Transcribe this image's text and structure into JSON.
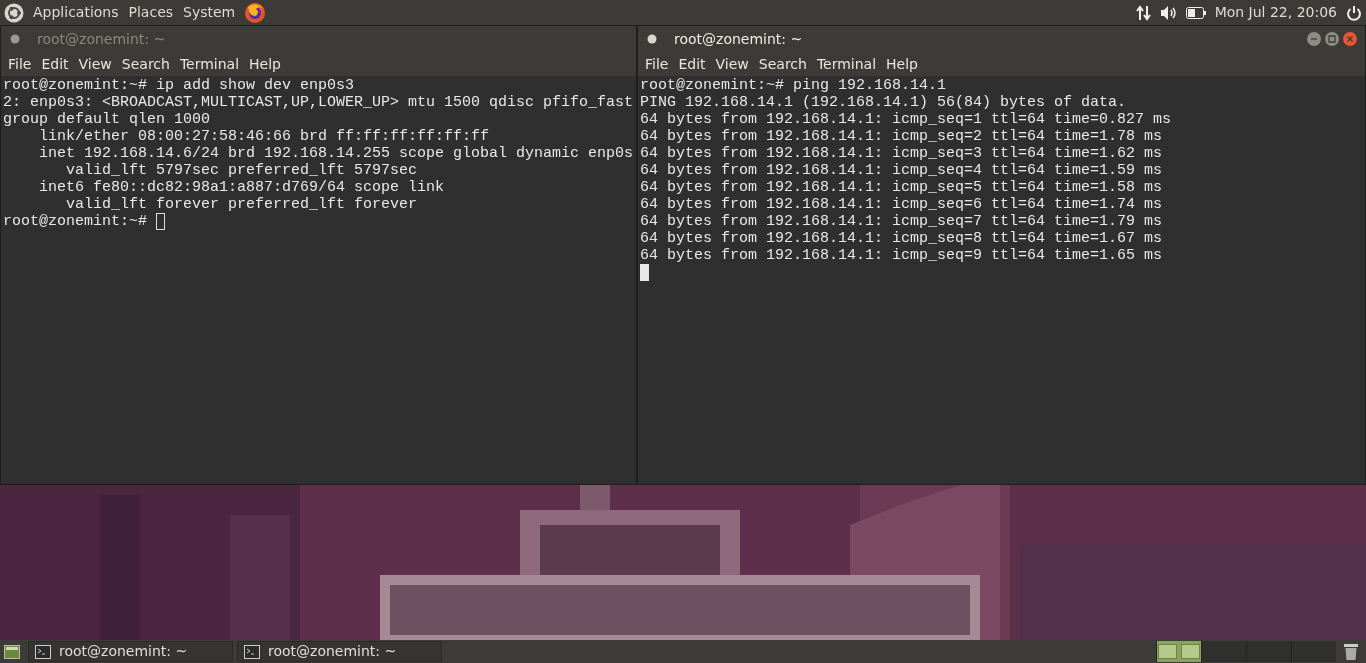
{
  "top_panel": {
    "menus": [
      "Applications",
      "Places",
      "System"
    ],
    "clock": "Mon Jul 22, 20:06"
  },
  "windows": [
    {
      "title": "root@zonemint: ~",
      "focused": false,
      "menu": [
        "File",
        "Edit",
        "View",
        "Search",
        "Terminal",
        "Help"
      ],
      "lines": [
        "root@zonemint:~# ip add show dev enp0s3",
        "2: enp0s3: <BROADCAST,MULTICAST,UP,LOWER_UP> mtu 1500 qdisc pfifo_fast",
        "group default qlen 1000",
        "    link/ether 08:00:27:58:46:66 brd ff:ff:ff:ff:ff:ff",
        "    inet 192.168.14.6/24 brd 192.168.14.255 scope global dynamic enp0s",
        "       valid_lft 5797sec preferred_lft 5797sec",
        "    inet6 fe80::dc82:98a1:a887:d769/64 scope link",
        "       valid_lft forever preferred_lft forever"
      ],
      "prompt": "root@zonemint:~#"
    },
    {
      "title": "root@zonemint: ~",
      "focused": true,
      "menu": [
        "File",
        "Edit",
        "View",
        "Search",
        "Terminal",
        "Help"
      ],
      "lines": [
        "root@zonemint:~# ping 192.168.14.1",
        "PING 192.168.14.1 (192.168.14.1) 56(84) bytes of data.",
        "64 bytes from 192.168.14.1: icmp_seq=1 ttl=64 time=0.827 ms",
        "64 bytes from 192.168.14.1: icmp_seq=2 ttl=64 time=1.78 ms",
        "64 bytes from 192.168.14.1: icmp_seq=3 ttl=64 time=1.62 ms",
        "64 bytes from 192.168.14.1: icmp_seq=4 ttl=64 time=1.59 ms",
        "64 bytes from 192.168.14.1: icmp_seq=5 ttl=64 time=1.58 ms",
        "64 bytes from 192.168.14.1: icmp_seq=6 ttl=64 time=1.74 ms",
        "64 bytes from 192.168.14.1: icmp_seq=7 ttl=64 time=1.79 ms",
        "64 bytes from 192.168.14.1: icmp_seq=8 ttl=64 time=1.67 ms",
        "64 bytes from 192.168.14.1: icmp_seq=9 ttl=64 time=1.65 ms"
      ]
    }
  ],
  "taskbar": {
    "tasks": [
      {
        "label": "root@zonemint: ~"
      },
      {
        "label": "root@zonemint: ~"
      }
    ],
    "workspaces": [
      {
        "selected": true
      },
      {
        "selected": false
      },
      {
        "selected": false
      },
      {
        "selected": false
      }
    ]
  }
}
